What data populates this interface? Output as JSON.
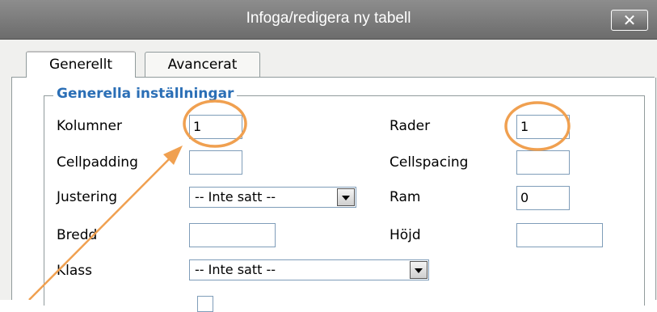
{
  "dialog": {
    "title": "Infoga/redigera ny tabell",
    "close_label": "✕"
  },
  "tabs": [
    {
      "label": "Generellt",
      "active": true
    },
    {
      "label": "Avancerat",
      "active": false
    }
  ],
  "section": {
    "legend": "Generella inställningar"
  },
  "fields": {
    "kolumner": {
      "label": "Kolumner",
      "value": "1"
    },
    "rader": {
      "label": "Rader",
      "value": "1"
    },
    "cellpadding": {
      "label": "Cellpadding",
      "value": ""
    },
    "cellspacing": {
      "label": "Cellspacing",
      "value": ""
    },
    "justering": {
      "label": "Justering",
      "value": "-- Inte satt --"
    },
    "ram": {
      "label": "Ram",
      "value": "0"
    },
    "bredd": {
      "label": "Bredd",
      "value": ""
    },
    "hojd": {
      "label": "Höjd",
      "value": ""
    },
    "klass": {
      "label": "Klass",
      "value": "-- Inte satt --"
    }
  },
  "colors": {
    "titlebar": "#7a7a7a",
    "legend": "#2b6fb6",
    "annotation": "#f0a050"
  }
}
